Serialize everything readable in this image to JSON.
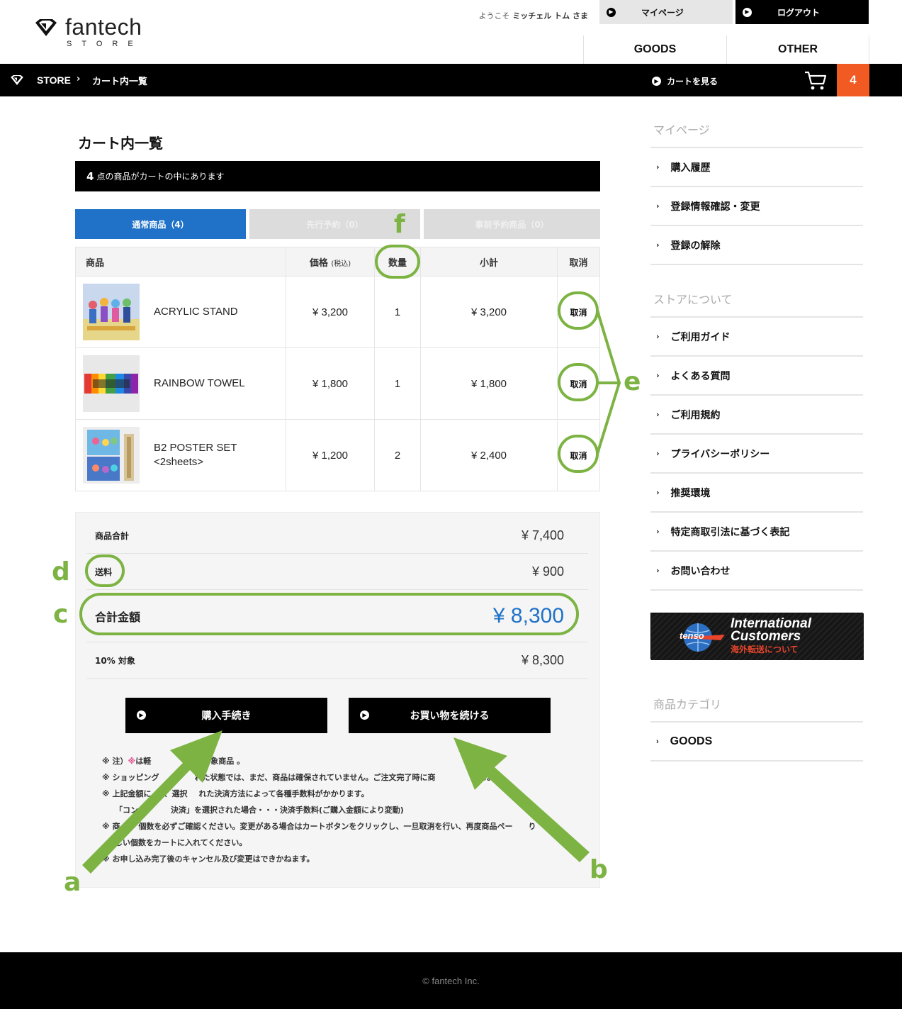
{
  "header": {
    "logo_text": "fantech",
    "logo_sub": "STORE",
    "welcome_prefix": "ようこそ",
    "welcome_name": "ミッチェル トム",
    "welcome_suffix": "さま",
    "mypage_label": "マイページ",
    "logout_label": "ログアウト",
    "nav": [
      "GOODS",
      "OTHER"
    ]
  },
  "breadcrumb": {
    "store": "STORE",
    "separator": "›",
    "current": "カート内一覧",
    "view_cart": "カートを見る",
    "cart_count": "4"
  },
  "main": {
    "title": "カート内一覧",
    "count_num": "4",
    "count_text": "点の商品がカートの中にあります",
    "tabs": [
      "通常商品（4）",
      "先行予約（0）",
      "事前予約商品（0）"
    ]
  },
  "table": {
    "headers": {
      "product": "商品",
      "price": "価格",
      "price_note": "(税込)",
      "qty": "数量",
      "subtotal": "小計",
      "cancel": "取消"
    },
    "rows": [
      {
        "name": "ACRYLIC STAND",
        "name2": "",
        "price": "¥ 3,200",
        "qty": "1",
        "subtotal": "¥ 3,200",
        "cancel": "取消"
      },
      {
        "name": "RAINBOW TOWEL",
        "name2": "",
        "price": "¥ 1,800",
        "qty": "1",
        "subtotal": "¥ 1,800",
        "cancel": "取消"
      },
      {
        "name": "B2 POSTER SET",
        "name2": "<2sheets>",
        "price": "¥ 1,200",
        "qty": "2",
        "subtotal": "¥ 2,400",
        "cancel": "取消"
      }
    ]
  },
  "summary": {
    "items_label": "商品合計",
    "items_value": "¥ 7,400",
    "shipping_label": "送料",
    "shipping_value": "¥ 900",
    "total_label": "合計金額",
    "total_value": "¥ 8,300",
    "tax_label": "10% 対象",
    "tax_value": "¥ 8,300",
    "checkout_label": "購入手続き",
    "continue_label": "お買い物を続ける"
  },
  "notes": {
    "n1_mark": "※",
    "n1a": "注）",
    "n1_pink": "※",
    "n1b": "は軽",
    "n1c": "象商品 。",
    "n2a": "ショッピング",
    "n2b": "れた状態では、まだ、商品は確保されていません。ご注文完了時に商",
    "n2c": "れます。",
    "n3a": "上記金額に",
    "n3b": "、選択",
    "n3c": "れた決済方法によって各種手数料がかかります。",
    "n3d": "「コン",
    "n3e": "決済」を選択された場合・・・決済手数料(ご購入金額により変動)",
    "n4a": "商",
    "n4b": "個数を必ずご確認ください。変更がある場合はカートボタンをクリックし、一旦取消を行い、再度商品ペー",
    "n4c": "り",
    "n4d": "しい個数をカートに入れてください。",
    "n5": "お申し込み完了後のキャンセル及び変更はできかねます。"
  },
  "sidebar": {
    "mypage_heading": "マイページ",
    "mypage_items": [
      "購入履歴",
      "登録情報確認・変更",
      "登録の解除"
    ],
    "about_heading": "ストアについて",
    "about_items": [
      "ご利用ガイド",
      "よくある質問",
      "ご利用規約",
      "プライバシーポリシー",
      "推奨環境",
      "特定商取引法に基づく表記",
      "お問い合わせ"
    ],
    "banner": {
      "logo": "tenso",
      "line1": "International",
      "line2": "Customers",
      "line3": "海外転送について"
    },
    "category_heading": "商品カテゴリ",
    "category_items": [
      "GOODS"
    ]
  },
  "annotations": {
    "a": "a",
    "b": "b",
    "c": "c",
    "d": "d",
    "e": "e",
    "f": "f"
  },
  "footer": {
    "copyright": "© fantech Inc."
  },
  "colors": {
    "accent_blue": "#1f72c8",
    "badge_orange": "#f15a22",
    "annotation_green": "#7cb342"
  }
}
